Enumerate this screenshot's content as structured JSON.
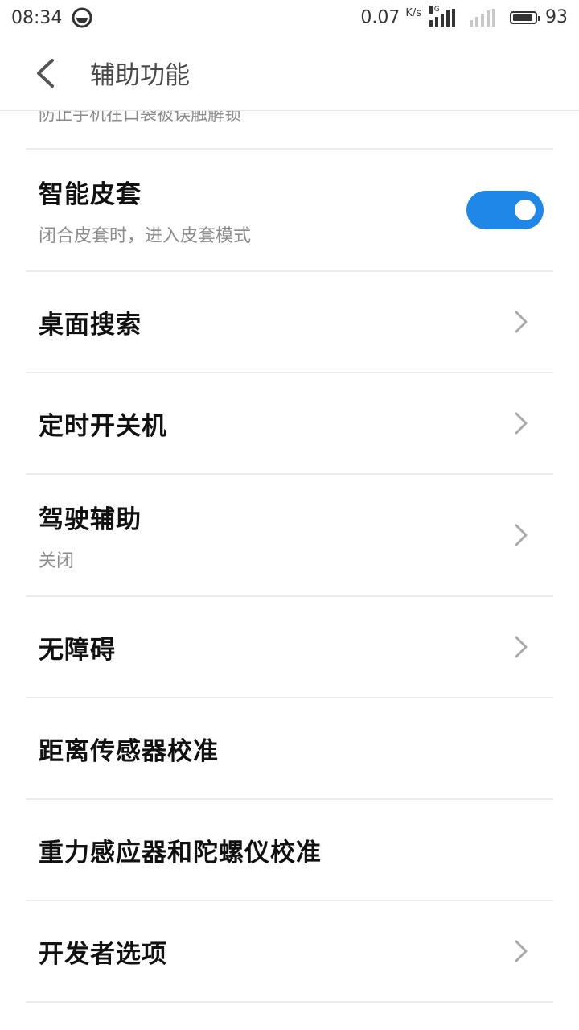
{
  "status_bar": {
    "time": "08:34",
    "speed_value": "0.07",
    "speed_unit": "K/s",
    "network_tag": "4G",
    "battery_level": "93",
    "battery_fraction": 0.93
  },
  "header": {
    "title": "辅助功能"
  },
  "list": {
    "partial_item_text": "防止手机在口袋被误触解锁",
    "items": [
      {
        "title": "智能皮套",
        "subtitle": "闭合皮套时，进入皮套模式",
        "control": "toggle",
        "toggle_on": true
      },
      {
        "title": "桌面搜索",
        "control": "chevron"
      },
      {
        "title": "定时开关机",
        "control": "chevron"
      },
      {
        "title": "驾驶辅助",
        "subtitle": "关闭",
        "control": "chevron"
      },
      {
        "title": "无障碍",
        "control": "chevron"
      },
      {
        "title": "距离传感器校准",
        "control": "none"
      },
      {
        "title": "重力感应器和陀螺仪校准",
        "control": "none"
      },
      {
        "title": "开发者选项",
        "control": "chevron"
      }
    ]
  },
  "colors": {
    "accent": "#1f87e8",
    "divider": "#ececec",
    "subtitle": "#8c8c8c"
  }
}
